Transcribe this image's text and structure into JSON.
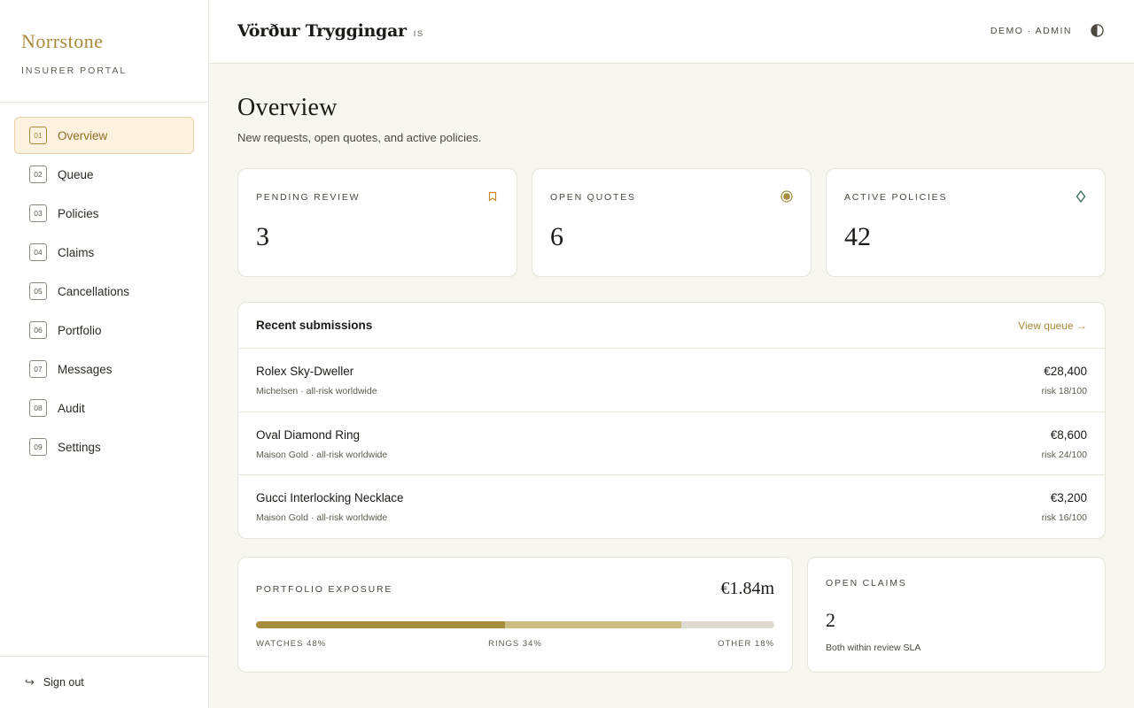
{
  "brand": {
    "name": "Norrstone",
    "subtitle": "INSURER PORTAL"
  },
  "sidebar": {
    "items": [
      {
        "num": "01",
        "label": "Overview",
        "active": true
      },
      {
        "num": "02",
        "label": "Queue"
      },
      {
        "num": "03",
        "label": "Policies"
      },
      {
        "num": "04",
        "label": "Claims"
      },
      {
        "num": "05",
        "label": "Cancellations"
      },
      {
        "num": "06",
        "label": "Portfolio"
      },
      {
        "num": "07",
        "label": "Messages"
      },
      {
        "num": "08",
        "label": "Audit"
      },
      {
        "num": "09",
        "label": "Settings"
      }
    ],
    "signout": {
      "icon": "sign-out-arrow-icon",
      "label": "Sign out"
    }
  },
  "header": {
    "org_name": "Vörður Tryggingar",
    "org_code": "IS",
    "role": "DEMO · ADMIN",
    "theme_icon": "half-circle-contrast-icon"
  },
  "main": {
    "title": "Overview",
    "subtitle": "New requests, open quotes, and active policies."
  },
  "stats": [
    {
      "label": "PENDING REVIEW",
      "value": "3",
      "icon": "bookmark-icon",
      "color": "#c8892e"
    },
    {
      "label": "OPEN QUOTES",
      "value": "6",
      "icon": "target-dot-icon",
      "color": "#a88a3b"
    },
    {
      "label": "ACTIVE POLICIES",
      "value": "42",
      "icon": "diamond-icon",
      "color": "#3a6b57"
    }
  ],
  "recent": {
    "title": "Recent submissions",
    "link_label": "View queue →",
    "rows": [
      {
        "name": "Rolex Sky-Dweller",
        "meta": "Michelsen · all-risk worldwide",
        "price": "€28,400",
        "risk": "risk 18/100"
      },
      {
        "name": "Oval Diamond Ring",
        "meta": "Maison Gold · all-risk worldwide",
        "price": "€8,600",
        "risk": "risk 24/100"
      },
      {
        "name": "Gucci Interlocking Necklace",
        "meta": "Maison Gold · all-risk worldwide",
        "price": "€3,200",
        "risk": "risk 16/100"
      }
    ]
  },
  "exposure": {
    "label": "PORTFOLIO EXPOSURE",
    "value": "€1.84m",
    "segments": [
      {
        "label": "WATCHES 48%",
        "share": 48,
        "color": "#a88a3b"
      },
      {
        "label": "RINGS 34%",
        "share": 34,
        "color": "#cdbd82"
      },
      {
        "label": "OTHER 18%",
        "share": 18,
        "color": "#dedad1"
      }
    ]
  },
  "claims": {
    "label": "OPEN CLAIMS",
    "value": "2",
    "note": "Both within review SLA"
  }
}
